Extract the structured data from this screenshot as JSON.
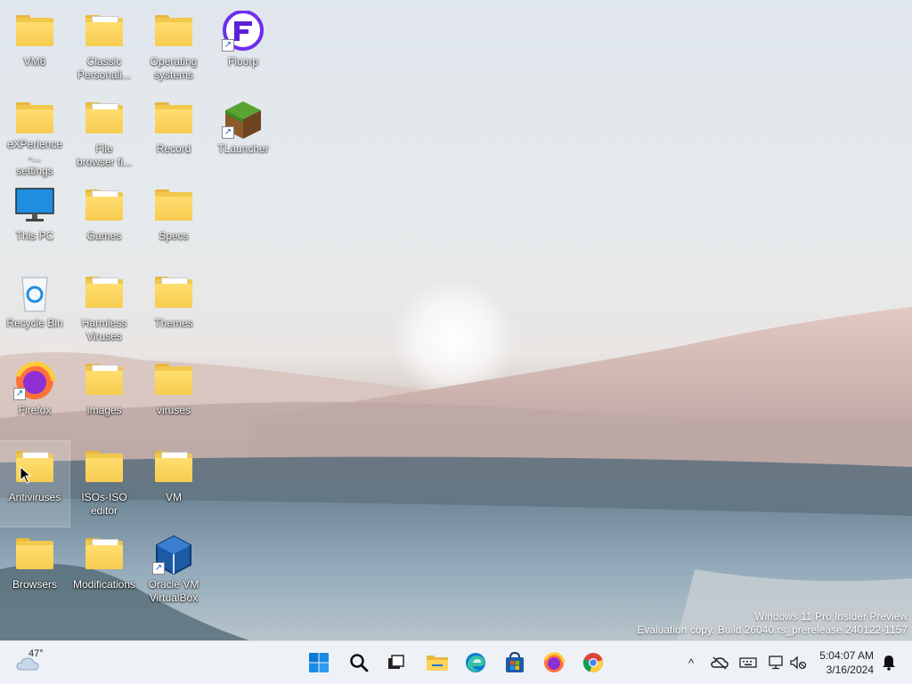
{
  "desktop": {
    "icons": [
      {
        "name": "desktop-icon-vm6",
        "label": "VM6",
        "kind": "folder"
      },
      {
        "name": "desktop-icon-classic-personalization",
        "label": "Classic\nPersonali...",
        "kind": "folder-content"
      },
      {
        "name": "desktop-icon-operating-systems",
        "label": "Operating\nsystems",
        "kind": "folder"
      },
      {
        "name": "desktop-icon-floorp",
        "label": "Floorp",
        "kind": "app-floorp"
      },
      {
        "name": "desktop-icon-experience-settings",
        "label": "eXPerience -...\nsettings",
        "kind": "folder"
      },
      {
        "name": "desktop-icon-file-browser",
        "label": "File\nbrowser fi...",
        "kind": "folder-content"
      },
      {
        "name": "desktop-icon-record",
        "label": "Record",
        "kind": "folder"
      },
      {
        "name": "desktop-icon-tlauncher",
        "label": "TLauncher",
        "kind": "app-tlauncher"
      },
      {
        "name": "desktop-icon-this-pc",
        "label": "This PC",
        "kind": "this-pc"
      },
      {
        "name": "desktop-icon-games",
        "label": "Games",
        "kind": "folder-content"
      },
      {
        "name": "desktop-icon-specs",
        "label": "Specs",
        "kind": "folder"
      },
      {
        "name": "desktop-icon-recycle-bin",
        "label": "Recycle Bin",
        "kind": "recycle"
      },
      {
        "name": "desktop-icon-harmless-viruses",
        "label": "Harmless\nViruses",
        "kind": "folder-content"
      },
      {
        "name": "desktop-icon-themes",
        "label": "Themes",
        "kind": "folder-content"
      },
      {
        "name": "desktop-icon-firefox",
        "label": "Firefox",
        "kind": "app-firefox"
      },
      {
        "name": "desktop-icon-images",
        "label": "Images",
        "kind": "folder-content"
      },
      {
        "name": "desktop-icon-viruses",
        "label": "viruses",
        "kind": "folder"
      },
      {
        "name": "desktop-icon-antiviruses",
        "label": "Antiviruses",
        "kind": "folder-content"
      },
      {
        "name": "desktop-icon-isos-iso-editor",
        "label": "ISOs-ISO\neditor",
        "kind": "folder"
      },
      {
        "name": "desktop-icon-vm",
        "label": "VM",
        "kind": "folder-content"
      },
      {
        "name": "desktop-icon-browsers",
        "label": "Browsers",
        "kind": "folder"
      },
      {
        "name": "desktop-icon-modifications",
        "label": "Modifications",
        "kind": "folder-content"
      },
      {
        "name": "desktop-icon-oracle-vm-virtualbox",
        "label": "Oracle VM\nVirtualBox",
        "kind": "app-virtualbox"
      }
    ],
    "watermark": {
      "line1": "Windows 11 Pro Insider Preview",
      "line2": "Evaluation copy. Build 26040.rs_prerelease.240122-1157"
    }
  },
  "taskbar": {
    "weather": {
      "temp": "47°",
      "icon": "cloud-icon"
    },
    "pinned": [
      {
        "name": "start-button",
        "icon": "windows-logo-icon"
      },
      {
        "name": "search-button",
        "icon": "search-icon"
      },
      {
        "name": "task-view-button",
        "icon": "task-view-icon"
      },
      {
        "name": "file-explorer-button",
        "icon": "folder-icon"
      },
      {
        "name": "edge-button",
        "icon": "edge-icon"
      },
      {
        "name": "store-button",
        "icon": "store-icon"
      },
      {
        "name": "firefox-button",
        "icon": "firefox-icon"
      },
      {
        "name": "chrome-button",
        "icon": "chrome-icon"
      }
    ],
    "tray": {
      "chevron": "^",
      "time": "5:04:07 AM",
      "date": "3/16/2024"
    }
  },
  "colors": {
    "folder": "#f7cc50",
    "taskbar": "#eef1f5",
    "accent": "#0078d4"
  }
}
